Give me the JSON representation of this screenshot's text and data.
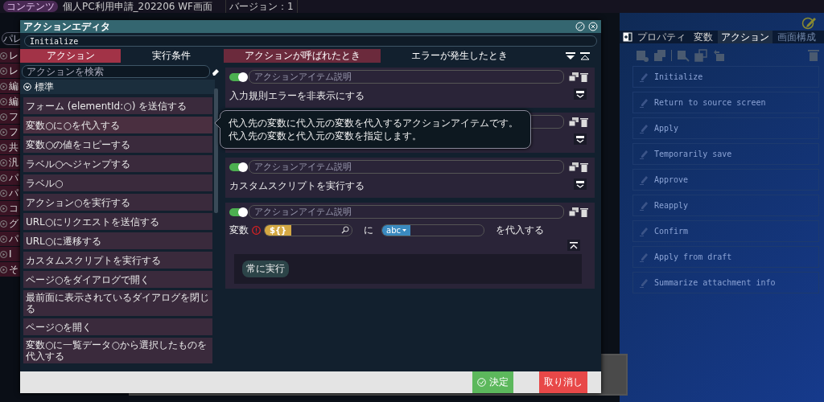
{
  "header": {
    "badge": "コンテンツ",
    "title": "個人PC利用申請_202206 WF画面",
    "version": "バージョン：1"
  },
  "palette": {
    "placeholder": "パレ",
    "items": [
      {
        "text": "レ"
      },
      {
        "text": "レ"
      },
      {
        "text": "編"
      },
      {
        "text": "編"
      },
      {
        "text": "フ"
      },
      {
        "text": "フ"
      },
      {
        "text": "共"
      },
      {
        "text": "汎"
      },
      {
        "text": "パ"
      },
      {
        "text": "パ"
      },
      {
        "text": "コ"
      },
      {
        "text": "グ"
      },
      {
        "text": "パ"
      },
      {
        "text": "I"
      },
      {
        "text": "そ"
      }
    ]
  },
  "right_panel": {
    "tabs": [
      {
        "label": "プロパティ",
        "selected": false,
        "disabled": false
      },
      {
        "label": "変数",
        "selected": false,
        "disabled": false
      },
      {
        "label": "アクション",
        "selected": true,
        "disabled": false
      },
      {
        "label": "画面構成",
        "selected": false,
        "disabled": true
      }
    ],
    "actions": [
      "Initialize",
      "Return to source screen",
      "Apply",
      "Temporarily save",
      "Approve",
      "Reapply",
      "Confirm",
      "Apply from draft",
      "Summarize attachment info"
    ]
  },
  "editor": {
    "title": "アクションエディタ",
    "name": "Initialize",
    "left_tabs": [
      {
        "label": "アクション",
        "selected": true
      },
      {
        "label": "実行条件",
        "selected": false
      }
    ],
    "right_tabs": [
      {
        "label": "アクションが呼ばれたとき",
        "selected": true
      },
      {
        "label": "エラーが発生したとき",
        "selected": false
      }
    ],
    "search_placeholder": "アクションを検索",
    "category": {
      "label": "標準",
      "expanded": true
    },
    "palette_items": [
      {
        "label": "フォーム (elementId:○) を送信する",
        "highlighted": false
      },
      {
        "label": "変数○に○を代入する",
        "highlighted": true
      },
      {
        "label": "変数○の値をコピーする",
        "highlighted": false
      },
      {
        "label": "ラベル○へジャンプする",
        "highlighted": false
      },
      {
        "label": "ラベル○",
        "highlighted": false
      },
      {
        "label": "アクション○を実行する",
        "highlighted": false
      },
      {
        "label": "URL○にリクエストを送信する",
        "highlighted": false
      },
      {
        "label": "URL○に遷移する",
        "highlighted": false
      },
      {
        "label": "カスタムスクリプトを実行する",
        "highlighted": false
      },
      {
        "label": "ページ○をダイアログで開く",
        "highlighted": false
      },
      {
        "label": "最前面に表示されているダイアログを閉じる",
        "highlighted": false
      },
      {
        "label": "ページ○を開く",
        "highlighted": false
      },
      {
        "label": "変数○に一覧データ○から選択したものを代入する",
        "highlighted": false
      }
    ],
    "items": [
      {
        "kind": "text",
        "on": true,
        "placeholder": "アクションアイテム説明",
        "label": "入力規則エラーを非表示にする",
        "expanded": false
      },
      {
        "kind": "text",
        "expanded": false
      },
      {
        "kind": "text",
        "on": true,
        "placeholder": "アクションアイテム説明",
        "label": "カスタムスクリプトを実行する",
        "expanded": false
      },
      {
        "kind": "assign",
        "on": true,
        "placeholder": "アクションアイテム説明",
        "prefix": "変数",
        "error": true,
        "variable": "${}",
        "middle": "に",
        "type": "abc",
        "suffix": "を代入する",
        "expanded": true,
        "condition": "常に実行"
      }
    ],
    "tooltip": [
      "代入先の変数に代入元の変数を代入するアクションアイテムです。",
      "代入先の変数と代入元の変数を指定します。"
    ],
    "buttons": [
      {
        "kind": "ok",
        "label": "決定"
      },
      {
        "kind": "cancel",
        "label": "取り消し"
      }
    ]
  }
}
